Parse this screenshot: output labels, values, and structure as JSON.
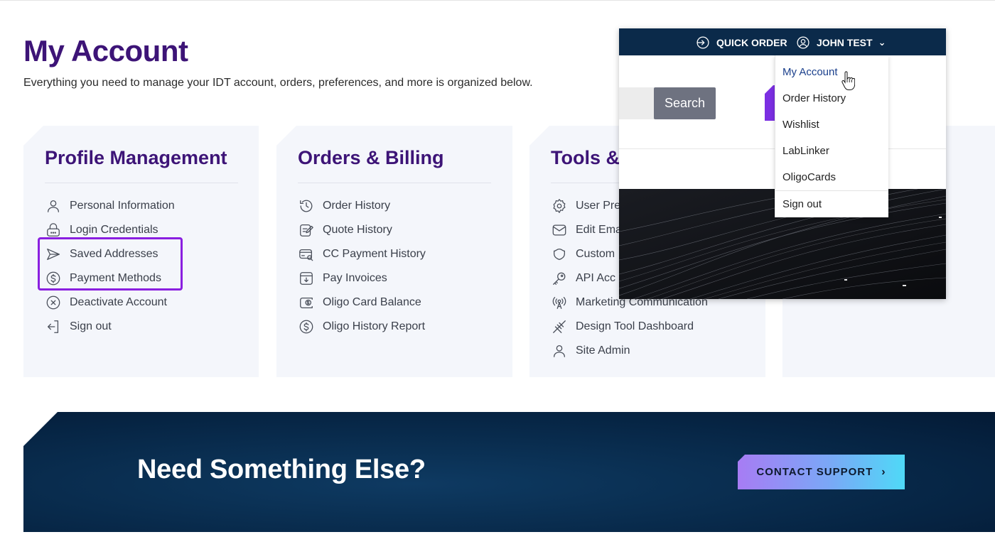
{
  "page": {
    "title": "My Account",
    "subtitle": "Everything you need to manage your IDT account, orders, preferences, and more is organized below."
  },
  "cards": [
    {
      "title": "Profile Management",
      "items": [
        {
          "label": "Personal Information",
          "icon": "person-icon"
        },
        {
          "label": "Login Credentials",
          "icon": "lock-icon"
        },
        {
          "label": "Saved Addresses",
          "icon": "send-icon"
        },
        {
          "label": "Payment Methods",
          "icon": "dollar-circle-icon"
        },
        {
          "label": "Deactivate Account",
          "icon": "x-circle-icon"
        },
        {
          "label": "Sign out",
          "icon": "sign-out-icon"
        }
      ]
    },
    {
      "title": "Orders & Billing",
      "items": [
        {
          "label": "Order History",
          "icon": "history-icon"
        },
        {
          "label": "Quote History",
          "icon": "quote-icon"
        },
        {
          "label": "CC Payment History",
          "icon": "card-search-icon"
        },
        {
          "label": "Pay Invoices",
          "icon": "invoice-icon"
        },
        {
          "label": "Oligo Card Balance",
          "icon": "card-balance-icon"
        },
        {
          "label": "Oligo History Report",
          "icon": "dollar-circle-icon"
        }
      ]
    },
    {
      "title": "Tools &",
      "items": [
        {
          "label": "User Pre",
          "icon": "gear-icon"
        },
        {
          "label": "Edit Ema",
          "icon": "mail-icon"
        },
        {
          "label": "Custom",
          "icon": "custom-icon"
        },
        {
          "label": "API Acc",
          "icon": "key-icon"
        },
        {
          "label": "Marketing Communication",
          "icon": "broadcast-icon"
        },
        {
          "label": "Design Tool Dashboard",
          "icon": "dna-icon"
        },
        {
          "label": "Site Admin",
          "icon": "person-icon"
        }
      ]
    }
  ],
  "banner": {
    "title": "Need Something Else?",
    "button_label": "CONTACT SUPPORT",
    "button_chevron": "›"
  },
  "header": {
    "quick_order": "QUICK ORDER",
    "user_name": "JOHN TEST",
    "caret": "⌄",
    "search_button": "Search"
  },
  "dropdown": {
    "items": [
      "My Account",
      "Order History",
      "Wishlist",
      "LabLinker",
      "OligoCards"
    ],
    "sign_out": "Sign out"
  },
  "colors": {
    "title_purple": "#3d1477",
    "highlight": "#8a1fe0",
    "navy": "#0b2a4a"
  }
}
